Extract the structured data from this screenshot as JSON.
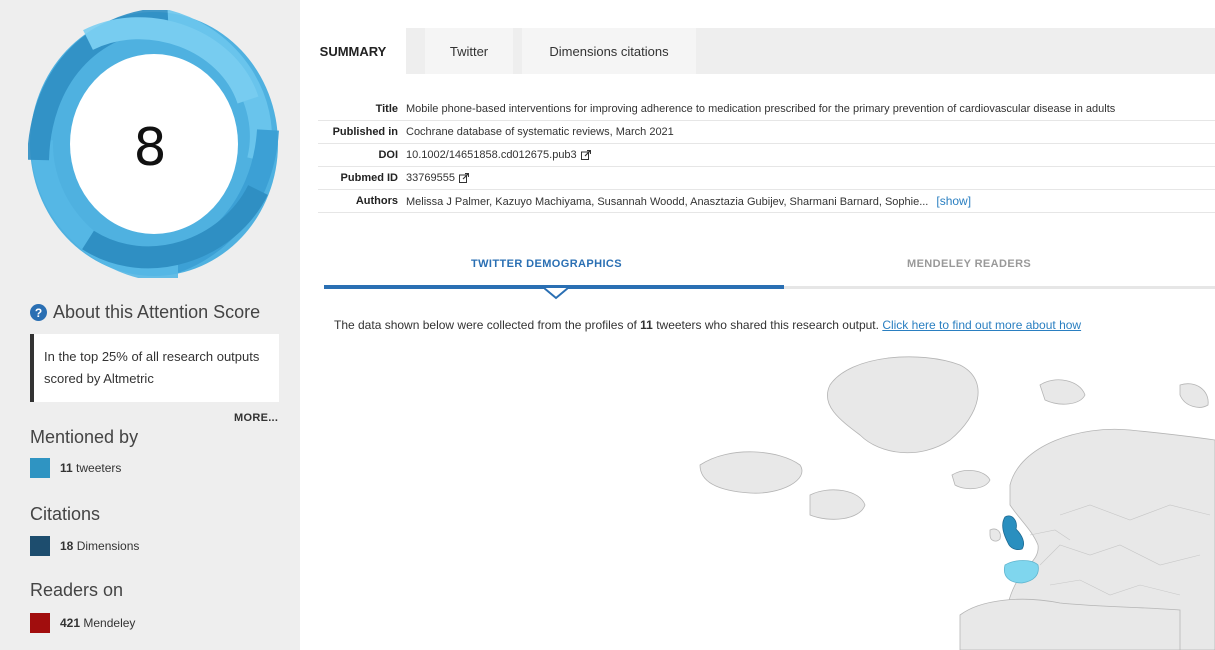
{
  "score": {
    "value": "8"
  },
  "about": {
    "label": "About this Attention Score",
    "icon": "question-circle-icon"
  },
  "rank_text": "In the top 25% of all research outputs scored by Altmetric",
  "more_label": "MORE...",
  "mentioned_by": {
    "heading": "Mentioned by",
    "items": [
      {
        "count": "11",
        "label": "tweeters",
        "color": "#2f94c2"
      }
    ]
  },
  "citations": {
    "heading": "Citations",
    "items": [
      {
        "count": "18",
        "label": "Dimensions",
        "color": "#1d4d6e"
      }
    ]
  },
  "readers": {
    "heading": "Readers on",
    "items": [
      {
        "count": "421",
        "label": "Mendeley",
        "color": "#a10d0d"
      }
    ]
  },
  "tabs": [
    "SUMMARY",
    "Twitter",
    "Dimensions citations"
  ],
  "meta": {
    "title_label": "Title",
    "title_value": "Mobile phone-based interventions for improving adherence to medication prescribed for the primary prevention of cardiovascular disease in adults",
    "published_label": "Published in",
    "published_value": "Cochrane database of systematic reviews, March 2021",
    "doi_label": "DOI",
    "doi_value": "10.1002/14651858.cd012675.pub3",
    "pubmed_label": "Pubmed ID",
    "pubmed_value": "33769555",
    "authors_label": "Authors",
    "authors_value": "Melissa J Palmer, Kazuyo Machiyama, Susannah Woodd, Anasztazia Gubijev, Sharmani Barnard, Sophie...",
    "show_label": "[show]"
  },
  "demo_tabs": [
    "TWITTER DEMOGRAPHICS",
    "MENDELEY READERS"
  ],
  "demographics": {
    "intro": "The data shown below were collected from the profiles of ",
    "count": "11",
    "intro_tail": " tweeters who shared this research output. ",
    "link": "Click here to find out more about how"
  },
  "colors": {
    "accent": "#2a6fb3",
    "uk": "#2a8fbf",
    "spain": "#7fd6ee"
  }
}
